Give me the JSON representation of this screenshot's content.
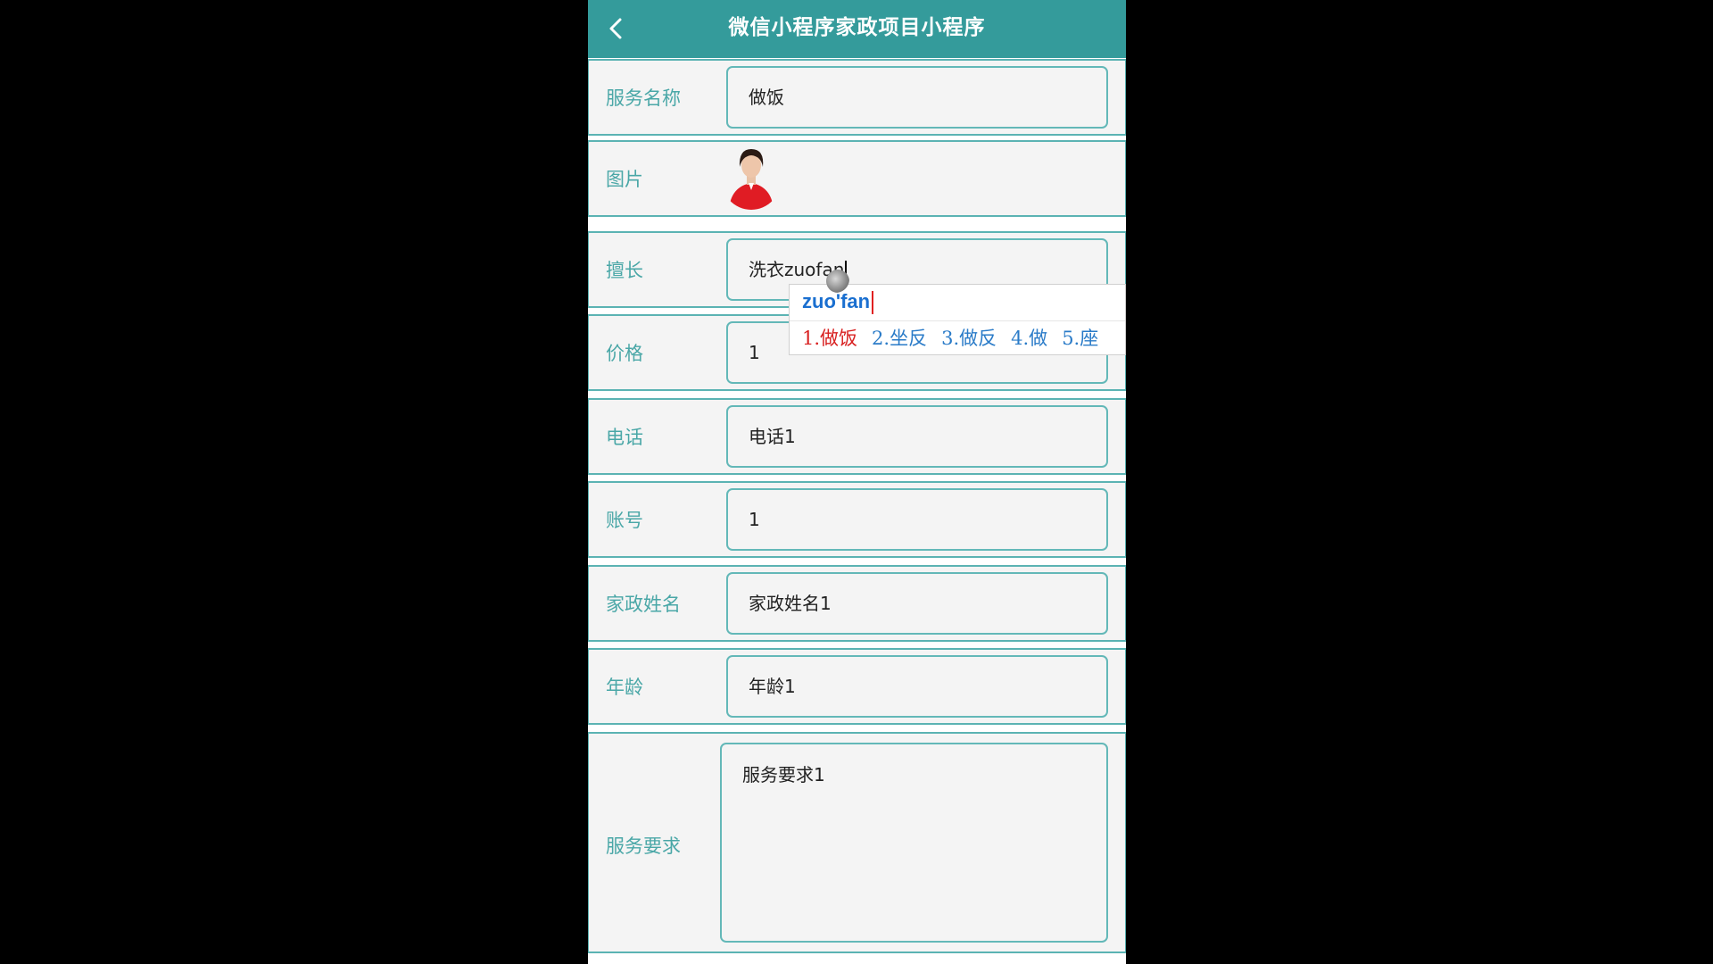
{
  "header": {
    "title": "微信小程序家政项目小程序"
  },
  "form": {
    "service_name": {
      "label": "服务名称",
      "value": "做饭"
    },
    "picture": {
      "label": "图片"
    },
    "specialty": {
      "label": "擅长",
      "value": "洗衣zuofan"
    },
    "price": {
      "label": "价格",
      "value": "1"
    },
    "phone": {
      "label": "电话",
      "value": "电话1"
    },
    "account": {
      "label": "账号",
      "value": "1"
    },
    "housekeeper_name": {
      "label": "家政姓名",
      "value": "家政姓名1"
    },
    "age": {
      "label": "年龄",
      "value": "年龄1"
    },
    "service_requirements": {
      "label": "服务要求",
      "value": "服务要求1"
    }
  },
  "ime": {
    "pinyin": "zuo'fan",
    "candidates": [
      "1.做饭",
      "2.坐反",
      "3.做反",
      "4.做",
      "5.座"
    ]
  },
  "colors": {
    "accent": "#349b9b",
    "label": "#4aa7a7",
    "border": "#63b8b8",
    "ime_first": "#d82020",
    "ime_other": "#2a7bc8"
  }
}
